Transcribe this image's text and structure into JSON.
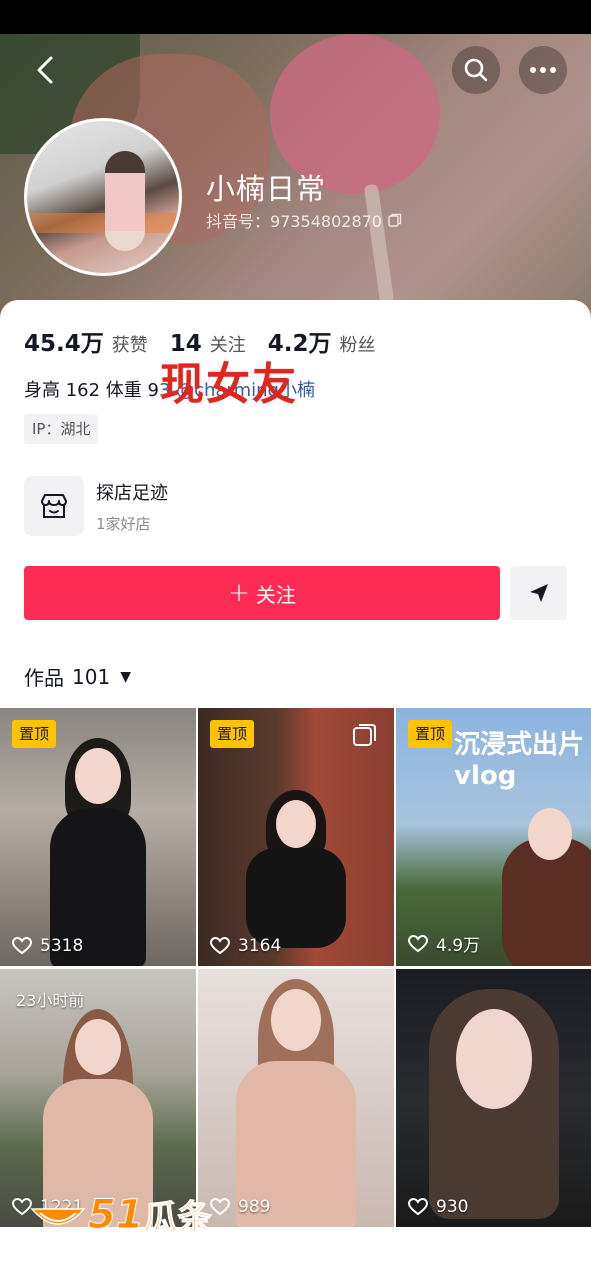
{
  "profile": {
    "nickname": "小楠日常",
    "douyin_id": "抖音号：97354802870"
  },
  "stats": [
    {
      "value": "45.4万",
      "label": "获赞"
    },
    {
      "value": "14",
      "label": "关注"
    },
    {
      "value": "4.2万",
      "label": "粉丝"
    }
  ],
  "bio": {
    "text": "身高 162 体重 9",
    "mention": "3 @charming小楠"
  },
  "overlay_text": "现女友",
  "ip_tag": "IP：湖北",
  "shop": {
    "title": "探店足迹",
    "subtitle": "1家好店"
  },
  "follow_button": {
    "label": "关注"
  },
  "works_tab": {
    "label": "作品",
    "count": "101"
  },
  "videos": [
    {
      "pinned": true,
      "pin_label": "置顶",
      "likes": "5318"
    },
    {
      "pinned": true,
      "pin_label": "置顶",
      "likes": "3164",
      "multi_image": true
    },
    {
      "pinned": true,
      "pin_label": "置顶",
      "likes": "4.9万",
      "overlay_title": "沉浸式出片 vlog"
    },
    {
      "pinned": false,
      "time_label": "23小时前",
      "likes": "1221"
    },
    {
      "pinned": false,
      "likes": "989"
    },
    {
      "pinned": false,
      "likes": "930"
    }
  ],
  "watermark": {
    "num": "51",
    "text": "瓜条"
  },
  "colors": {
    "accent": "#fe2c55",
    "pin": "#ffc300",
    "overlay_red": "#e0261f"
  }
}
